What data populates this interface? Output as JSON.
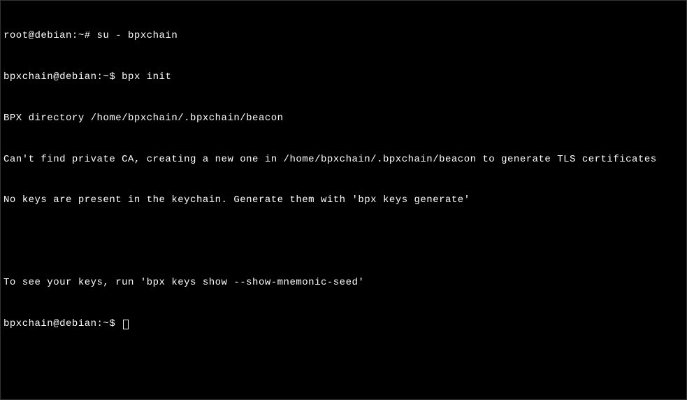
{
  "terminal": {
    "lines": [
      {
        "prompt": "root@debian:~#",
        "command": " su - bpxchain"
      },
      {
        "prompt": "bpxchain@debian:~$",
        "command": " bpx init"
      },
      {
        "text": "BPX directory /home/bpxchain/.bpxchain/beacon"
      },
      {
        "text": "Can't find private CA, creating a new one in /home/bpxchain/.bpxchain/beacon to generate TLS certificates"
      },
      {
        "text": "No keys are present in the keychain. Generate them with 'bpx keys generate'"
      },
      {
        "text": ""
      },
      {
        "text": "To see your keys, run 'bpx keys show --show-mnemonic-seed'"
      },
      {
        "prompt": "bpxchain@debian:~$",
        "command": " ",
        "cursor": true
      }
    ]
  }
}
